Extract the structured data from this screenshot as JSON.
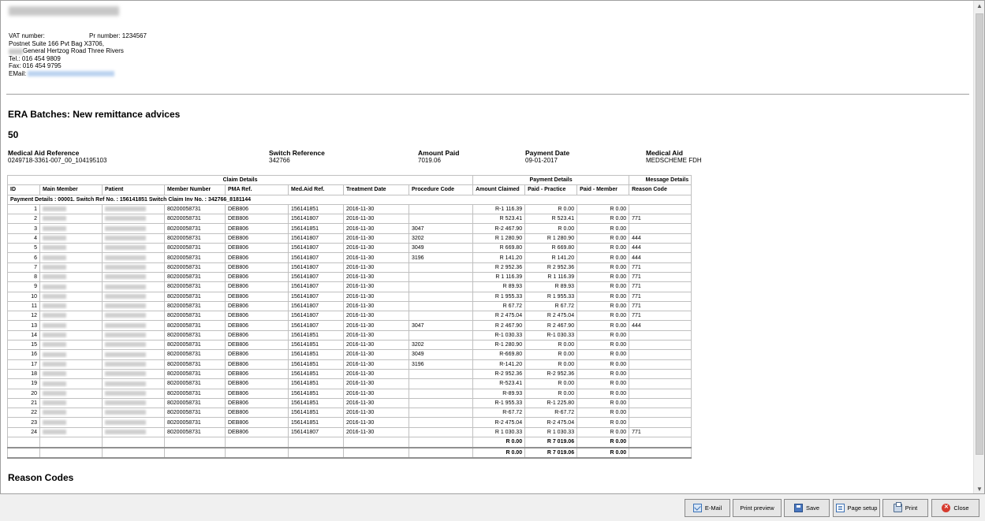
{
  "header": {
    "vat_label": "VAT number:",
    "pr_number": "Pr number: 1234567",
    "lines": [
      "Postnet Suite 166 Pvt Bag X3706,",
      "General Hertzog Road Three Rivers",
      "Tel.: 016 454 9809",
      "Fax: 016 454 9795"
    ],
    "email_label": "EMail:"
  },
  "report": {
    "title": "ERA Batches: New remittance advices",
    "batch": "50"
  },
  "summary": {
    "medical_aid_reference": {
      "label": "Medical Aid Reference",
      "value": "0249718-3361-007_00_104195103"
    },
    "switch_reference": {
      "label": "Switch Reference",
      "value": "342766"
    },
    "amount_paid": {
      "label": "Amount Paid",
      "value": "7019.06"
    },
    "payment_date": {
      "label": "Payment Date",
      "value": "09-01-2017"
    },
    "medical_aid": {
      "label": "Medical Aid",
      "value": "MEDSCHEME FDH"
    }
  },
  "table": {
    "groups": {
      "claim": "Claim Details",
      "payment": "Payment Details",
      "message": "Message Details"
    },
    "columns": [
      "ID",
      "Main Member",
      "Patient",
      "Member Number",
      "PMA Ref.",
      "Med.Aid Ref.",
      "Treatment Date",
      "Procedure Code",
      "Amount Claimed",
      "Paid - Practice",
      "Paid - Member",
      "Reason Code"
    ],
    "payment_row": "Payment Details : 00001. Switch Ref No. : 156141851 Switch Claim Inv No. : 342766_8181144",
    "rows": [
      {
        "id": "1",
        "member_number": "80200058731",
        "pma_ref": "DEB806",
        "med_aid_ref": "156141851",
        "treatment_date": "2016-11-30",
        "procedure_code": "",
        "amount_claimed": "R-1 116.39",
        "paid_practice": "R 0.00",
        "paid_member": "R 0.00",
        "reason_code": ""
      },
      {
        "id": "2",
        "member_number": "80200058731",
        "pma_ref": "DEB806",
        "med_aid_ref": "156141807",
        "treatment_date": "2016-11-30",
        "procedure_code": "",
        "amount_claimed": "R 523.41",
        "paid_practice": "R 523.41",
        "paid_member": "R 0.00",
        "reason_code": "771"
      },
      {
        "id": "3",
        "member_number": "80200058731",
        "pma_ref": "DEB806",
        "med_aid_ref": "156141851",
        "treatment_date": "2016-11-30",
        "procedure_code": "3047",
        "amount_claimed": "R-2 467.90",
        "paid_practice": "R 0.00",
        "paid_member": "R 0.00",
        "reason_code": ""
      },
      {
        "id": "4",
        "member_number": "80200058731",
        "pma_ref": "DEB806",
        "med_aid_ref": "156141807",
        "treatment_date": "2016-11-30",
        "procedure_code": "3202",
        "amount_claimed": "R 1 280.90",
        "paid_practice": "R 1 280.90",
        "paid_member": "R 0.00",
        "reason_code": "444"
      },
      {
        "id": "5",
        "member_number": "80200058731",
        "pma_ref": "DEB806",
        "med_aid_ref": "156141807",
        "treatment_date": "2016-11-30",
        "procedure_code": "3049",
        "amount_claimed": "R 669.80",
        "paid_practice": "R 669.80",
        "paid_member": "R 0.00",
        "reason_code": "444"
      },
      {
        "id": "6",
        "member_number": "80200058731",
        "pma_ref": "DEB806",
        "med_aid_ref": "156141807",
        "treatment_date": "2016-11-30",
        "procedure_code": "3196",
        "amount_claimed": "R 141.20",
        "paid_practice": "R 141.20",
        "paid_member": "R 0.00",
        "reason_code": "444"
      },
      {
        "id": "7",
        "member_number": "80200058731",
        "pma_ref": "DEB806",
        "med_aid_ref": "156141807",
        "treatment_date": "2016-11-30",
        "procedure_code": "",
        "amount_claimed": "R 2 952.36",
        "paid_practice": "R 2 952.36",
        "paid_member": "R 0.00",
        "reason_code": "771"
      },
      {
        "id": "8",
        "member_number": "80200058731",
        "pma_ref": "DEB806",
        "med_aid_ref": "156141807",
        "treatment_date": "2016-11-30",
        "procedure_code": "",
        "amount_claimed": "R 1 116.39",
        "paid_practice": "R 1 116.39",
        "paid_member": "R 0.00",
        "reason_code": "771"
      },
      {
        "id": "9",
        "member_number": "80200058731",
        "pma_ref": "DEB806",
        "med_aid_ref": "156141807",
        "treatment_date": "2016-11-30",
        "procedure_code": "",
        "amount_claimed": "R 89.93",
        "paid_practice": "R 89.93",
        "paid_member": "R 0.00",
        "reason_code": "771"
      },
      {
        "id": "10",
        "member_number": "80200058731",
        "pma_ref": "DEB806",
        "med_aid_ref": "156141807",
        "treatment_date": "2016-11-30",
        "procedure_code": "",
        "amount_claimed": "R 1 955.33",
        "paid_practice": "R 1 955.33",
        "paid_member": "R 0.00",
        "reason_code": "771"
      },
      {
        "id": "11",
        "member_number": "80200058731",
        "pma_ref": "DEB806",
        "med_aid_ref": "156141807",
        "treatment_date": "2016-11-30",
        "procedure_code": "",
        "amount_claimed": "R 67.72",
        "paid_practice": "R 67.72",
        "paid_member": "R 0.00",
        "reason_code": "771"
      },
      {
        "id": "12",
        "member_number": "80200058731",
        "pma_ref": "DEB806",
        "med_aid_ref": "156141807",
        "treatment_date": "2016-11-30",
        "procedure_code": "",
        "amount_claimed": "R 2 475.04",
        "paid_practice": "R 2 475.04",
        "paid_member": "R 0.00",
        "reason_code": "771"
      },
      {
        "id": "13",
        "member_number": "80200058731",
        "pma_ref": "DEB806",
        "med_aid_ref": "156141807",
        "treatment_date": "2016-11-30",
        "procedure_code": "3047",
        "amount_claimed": "R 2 467.90",
        "paid_practice": "R 2 467.90",
        "paid_member": "R 0.00",
        "reason_code": "444"
      },
      {
        "id": "14",
        "member_number": "80200058731",
        "pma_ref": "DEB806",
        "med_aid_ref": "156141851",
        "treatment_date": "2016-11-30",
        "procedure_code": "",
        "amount_claimed": "R-1 030.33",
        "paid_practice": "R-1 030.33",
        "paid_member": "R 0.00",
        "reason_code": ""
      },
      {
        "id": "15",
        "member_number": "80200058731",
        "pma_ref": "DEB806",
        "med_aid_ref": "156141851",
        "treatment_date": "2016-11-30",
        "procedure_code": "3202",
        "amount_claimed": "R-1 280.90",
        "paid_practice": "R 0.00",
        "paid_member": "R 0.00",
        "reason_code": ""
      },
      {
        "id": "16",
        "member_number": "80200058731",
        "pma_ref": "DEB806",
        "med_aid_ref": "156141851",
        "treatment_date": "2016-11-30",
        "procedure_code": "3049",
        "amount_claimed": "R-669.80",
        "paid_practice": "R 0.00",
        "paid_member": "R 0.00",
        "reason_code": ""
      },
      {
        "id": "17",
        "member_number": "80200058731",
        "pma_ref": "DEB806",
        "med_aid_ref": "156141851",
        "treatment_date": "2016-11-30",
        "procedure_code": "3196",
        "amount_claimed": "R-141.20",
        "paid_practice": "R 0.00",
        "paid_member": "R 0.00",
        "reason_code": ""
      },
      {
        "id": "18",
        "member_number": "80200058731",
        "pma_ref": "DEB806",
        "med_aid_ref": "156141851",
        "treatment_date": "2016-11-30",
        "procedure_code": "",
        "amount_claimed": "R-2 952.36",
        "paid_practice": "R-2 952.36",
        "paid_member": "R 0.00",
        "reason_code": ""
      },
      {
        "id": "19",
        "member_number": "80200058731",
        "pma_ref": "DEB806",
        "med_aid_ref": "156141851",
        "treatment_date": "2016-11-30",
        "procedure_code": "",
        "amount_claimed": "R-523.41",
        "paid_practice": "R 0.00",
        "paid_member": "R 0.00",
        "reason_code": ""
      },
      {
        "id": "20",
        "member_number": "80200058731",
        "pma_ref": "DEB806",
        "med_aid_ref": "156141851",
        "treatment_date": "2016-11-30",
        "procedure_code": "",
        "amount_claimed": "R-89.93",
        "paid_practice": "R 0.00",
        "paid_member": "R 0.00",
        "reason_code": ""
      },
      {
        "id": "21",
        "member_number": "80200058731",
        "pma_ref": "DEB806",
        "med_aid_ref": "156141851",
        "treatment_date": "2016-11-30",
        "procedure_code": "",
        "amount_claimed": "R-1 955.33",
        "paid_practice": "R-1 225.80",
        "paid_member": "R 0.00",
        "reason_code": ""
      },
      {
        "id": "22",
        "member_number": "80200058731",
        "pma_ref": "DEB806",
        "med_aid_ref": "156141851",
        "treatment_date": "2016-11-30",
        "procedure_code": "",
        "amount_claimed": "R-67.72",
        "paid_practice": "R-67.72",
        "paid_member": "R 0.00",
        "reason_code": ""
      },
      {
        "id": "23",
        "member_number": "80200058731",
        "pma_ref": "DEB806",
        "med_aid_ref": "156141851",
        "treatment_date": "2016-11-30",
        "procedure_code": "",
        "amount_claimed": "R-2 475.04",
        "paid_practice": "R-2 475.04",
        "paid_member": "R 0.00",
        "reason_code": ""
      },
      {
        "id": "24",
        "member_number": "80200058731",
        "pma_ref": "DEB806",
        "med_aid_ref": "156141807",
        "treatment_date": "2016-11-30",
        "procedure_code": "",
        "amount_claimed": "R 1 030.33",
        "paid_practice": "R 1 030.33",
        "paid_member": "R 0.00",
        "reason_code": "771"
      }
    ],
    "totals": [
      {
        "amount_claimed": "R 0.00",
        "paid_practice": "R 7 019.06",
        "paid_member": "R 0.00"
      },
      {
        "amount_claimed": "R 0.00",
        "paid_practice": "R 7 019.06",
        "paid_member": "R 0.00"
      }
    ]
  },
  "reason_codes_title": "Reason Codes",
  "buttons": {
    "email": "E-Mail",
    "print_preview": "Print preview",
    "save": "Save",
    "page_setup": "Page setup",
    "print": "Print",
    "close": "Close"
  }
}
